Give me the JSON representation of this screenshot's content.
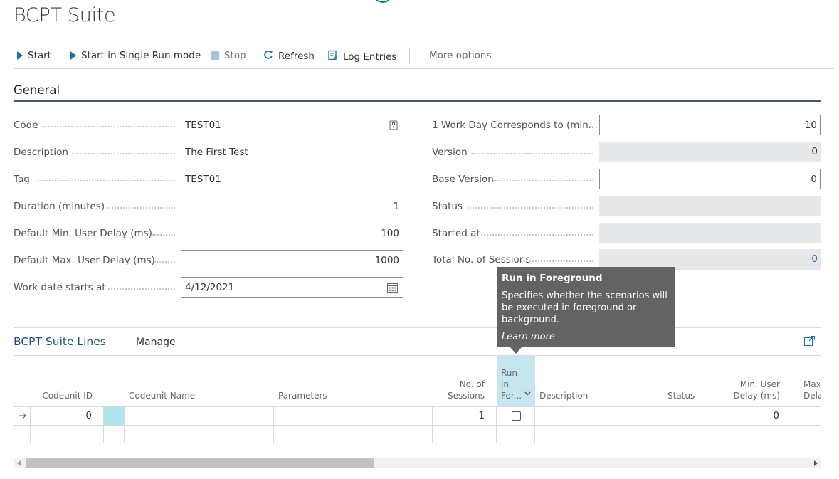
{
  "page": {
    "title": "BCPT Suite"
  },
  "actions": {
    "start": "Start",
    "start_single": "Start in Single Run mode",
    "stop": "Stop",
    "refresh": "Refresh",
    "log_entries": "Log Entries",
    "more_options": "More options"
  },
  "general": {
    "title": "General",
    "code": {
      "label": "Code",
      "value": "TEST01"
    },
    "description": {
      "label": "Description",
      "value": "The First Test"
    },
    "tag": {
      "label": "Tag",
      "value": "TEST01"
    },
    "duration": {
      "label": "Duration (minutes)",
      "value": "1"
    },
    "min_delay": {
      "label": "Default Min. User Delay (ms)",
      "value": "100"
    },
    "max_delay": {
      "label": "Default Max. User Delay (ms)",
      "value": "1000"
    },
    "work_date": {
      "label": "Work date starts at",
      "value": "4/12/2021"
    },
    "work_day": {
      "label": "1 Work Day Corresponds to (min...",
      "value": "10"
    },
    "version": {
      "label": "Version",
      "value": "0"
    },
    "base_version": {
      "label": "Base Version",
      "value": "0"
    },
    "status": {
      "label": "Status",
      "value": ""
    },
    "started_at": {
      "label": "Started at",
      "value": ""
    },
    "total_sessions": {
      "label": "Total No. of Sessions",
      "value": "0"
    }
  },
  "lines": {
    "title": "BCPT Suite Lines",
    "manage": "Manage",
    "columns": {
      "codeunit_id": "Codeunit ID",
      "codeunit_name": "Codeunit Name",
      "parameters": "Parameters",
      "sessions_1": "No. of",
      "sessions_2": "Sessions",
      "fg_1": "Run",
      "fg_2": "in",
      "fg_3": "For...",
      "description": "Description",
      "status": "Status",
      "min_1": "Min. User",
      "min_2": "Delay (ms)",
      "max_1": "Max.",
      "max_2": "Delay"
    },
    "rows": [
      {
        "codeunit_id": "0",
        "codeunit_name": "",
        "parameters": "",
        "sessions": "1",
        "run_in_foreground": false,
        "description": "",
        "status": "",
        "min_delay": "0",
        "max_delay": ""
      }
    ]
  },
  "tooltip": {
    "title": "Run in Foreground",
    "body": "Specifies whether the scenarios will be executed in foreground or background.",
    "link": "Learn more"
  },
  "colors": {
    "accent": "#1f6f9f",
    "highlight": "#b3e5ec",
    "tooltip_bg": "#636363"
  }
}
